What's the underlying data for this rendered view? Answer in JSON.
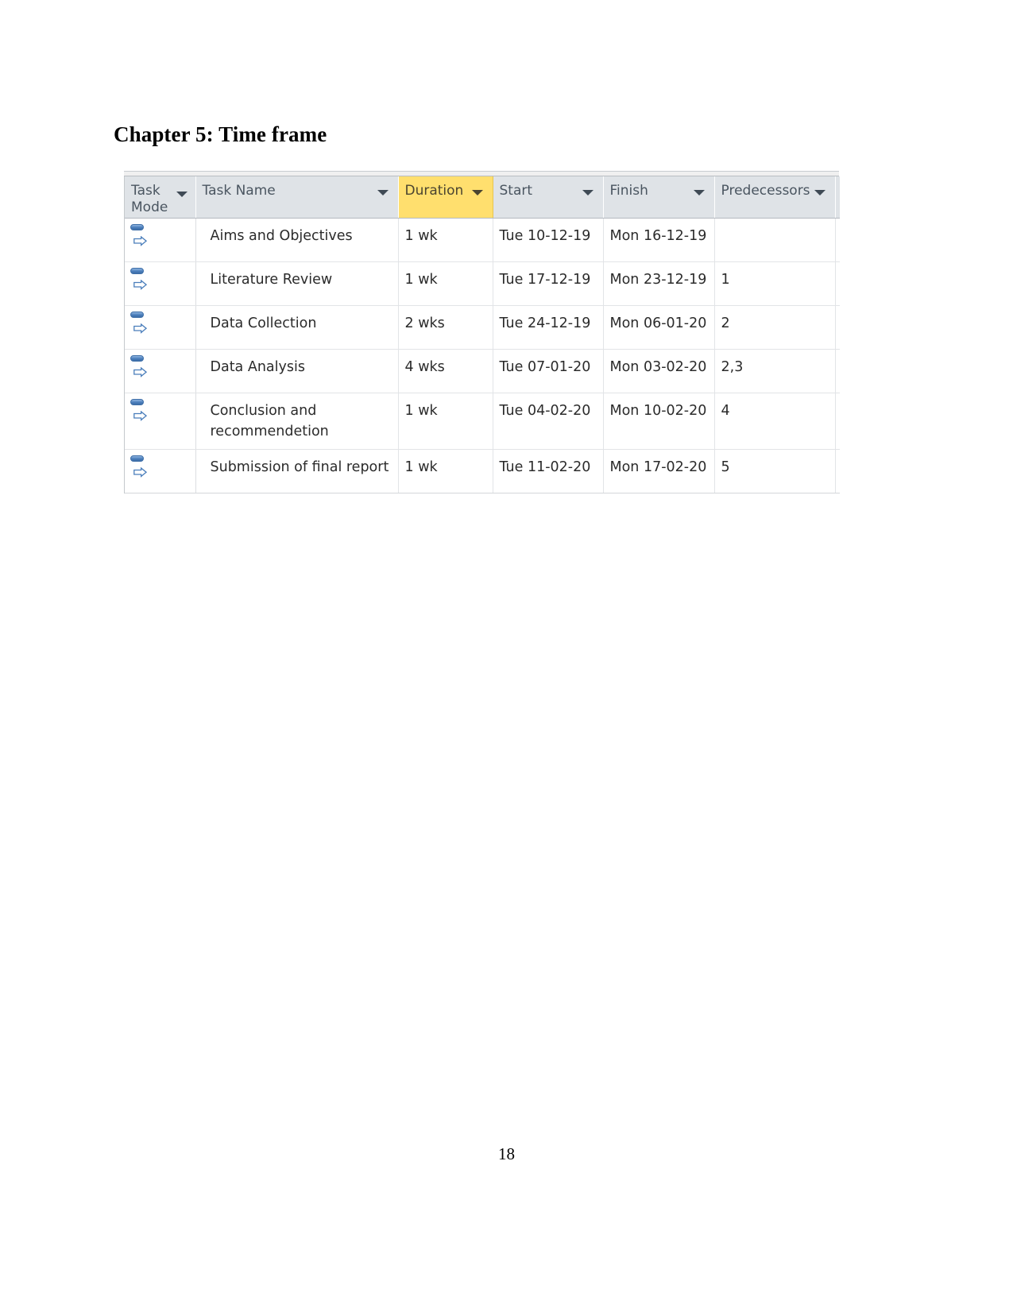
{
  "document": {
    "heading": "Chapter 5: Time frame",
    "page_number": "18"
  },
  "project_table": {
    "name": "microsoft-project-task-sheet",
    "highlight_color": "#ffdf6e",
    "header_background": "#dfe3e7",
    "columns": [
      {
        "key": "task_mode",
        "label": "Task\nMode",
        "has_filter": true,
        "highlighted": false
      },
      {
        "key": "task_name",
        "label": "Task Name",
        "has_filter": true,
        "highlighted": false
      },
      {
        "key": "duration",
        "label": "Duration",
        "has_filter": true,
        "highlighted": true
      },
      {
        "key": "start",
        "label": "Start",
        "has_filter": true,
        "highlighted": false
      },
      {
        "key": "finish",
        "label": "Finish",
        "has_filter": true,
        "highlighted": false
      },
      {
        "key": "predecessors",
        "label": "Predecessors",
        "has_filter": true,
        "highlighted": false
      }
    ],
    "task_mode_icon": "auto-scheduled-icon",
    "rows": [
      {
        "task_mode_icon": "auto-scheduled-icon",
        "task_name": "Aims and Objectives",
        "duration": "1 wk",
        "start": "Tue 10-12-19",
        "finish": "Mon 16-12-19",
        "predecessors": ""
      },
      {
        "task_mode_icon": "auto-scheduled-icon",
        "task_name": "Literature Review",
        "duration": "1 wk",
        "start": "Tue 17-12-19",
        "finish": "Mon 23-12-19",
        "predecessors": "1"
      },
      {
        "task_mode_icon": "auto-scheduled-icon",
        "task_name": "Data Collection",
        "duration": "2 wks",
        "start": "Tue 24-12-19",
        "finish": "Mon 06-01-20",
        "predecessors": "2"
      },
      {
        "task_mode_icon": "auto-scheduled-icon",
        "task_name": "Data Analysis",
        "duration": "4 wks",
        "start": "Tue 07-01-20",
        "finish": "Mon 03-02-20",
        "predecessors": "2,3"
      },
      {
        "task_mode_icon": "auto-scheduled-icon",
        "task_name": "Conclusion and recommendetion",
        "duration": "1 wk",
        "start": "Tue 04-02-20",
        "finish": "Mon 10-02-20",
        "predecessors": "4"
      },
      {
        "task_mode_icon": "auto-scheduled-icon",
        "task_name": "Submission of final report",
        "duration": "1 wk",
        "start": "Tue 11-02-20",
        "finish": "Mon 17-02-20",
        "predecessors": "5"
      }
    ]
  }
}
